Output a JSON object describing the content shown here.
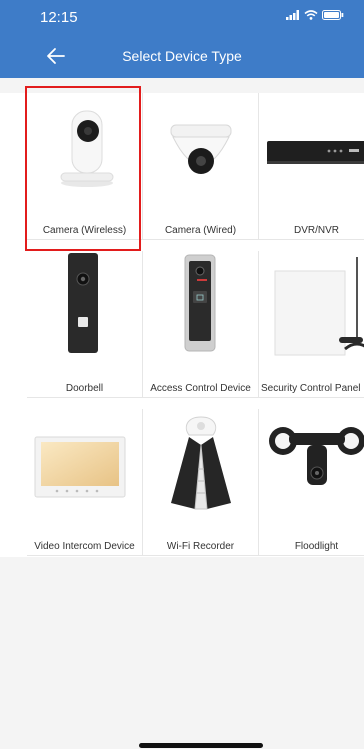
{
  "status_bar": {
    "time": "12:15"
  },
  "header": {
    "title": "Select Device Type"
  },
  "devices": [
    {
      "label": "Camera (Wireless)",
      "selected": true
    },
    {
      "label": "Camera (Wired)"
    },
    {
      "label": "DVR/NVR"
    },
    {
      "label": "Doorbell"
    },
    {
      "label": "Access Control Device"
    },
    {
      "label": "Security Control Panel"
    },
    {
      "label": "Video Intercom Device"
    },
    {
      "label": "Wi-Fi Recorder"
    },
    {
      "label": "Floodlight"
    }
  ],
  "colors": {
    "header": "#3e7cc8",
    "selection": "#e21c1c"
  }
}
